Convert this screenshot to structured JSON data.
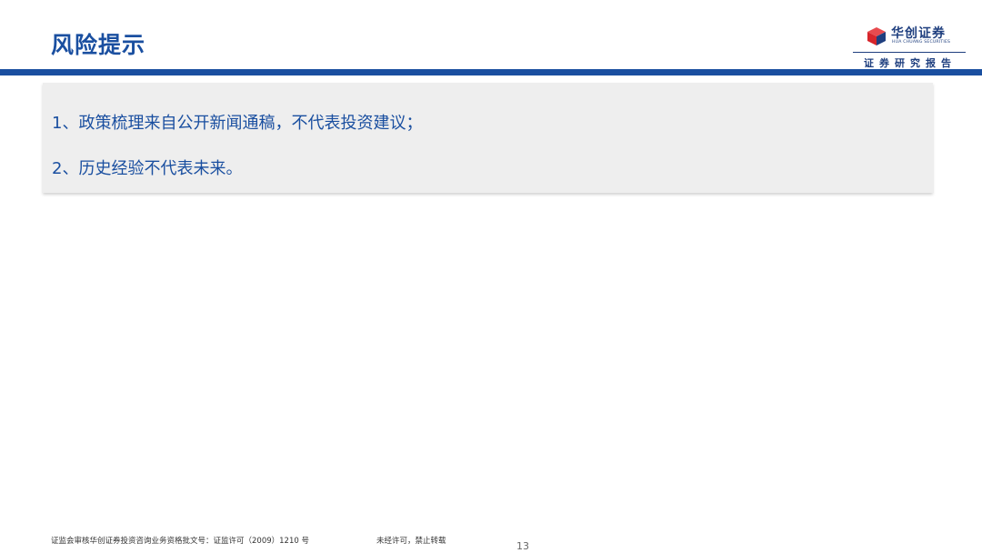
{
  "header": {
    "title": "风险提示",
    "logo_name": "华创证券",
    "logo_english": "HUA CHUANG SECURITIES",
    "tagline": "证券研究报告",
    "accent_color": "#1a4fa0",
    "logo_red": "#d7262c"
  },
  "notice": {
    "items": [
      "1、政策梳理来自公开新闻通稿，不代表投资建议；",
      "2、历史经验不代表未来。"
    ]
  },
  "footer": {
    "license": "证监会审核华创证券投资咨询业务资格批文号：证监许可（2009）1210 号",
    "reproduction_notice": "未经许可，禁止转载",
    "page_number": "13"
  }
}
